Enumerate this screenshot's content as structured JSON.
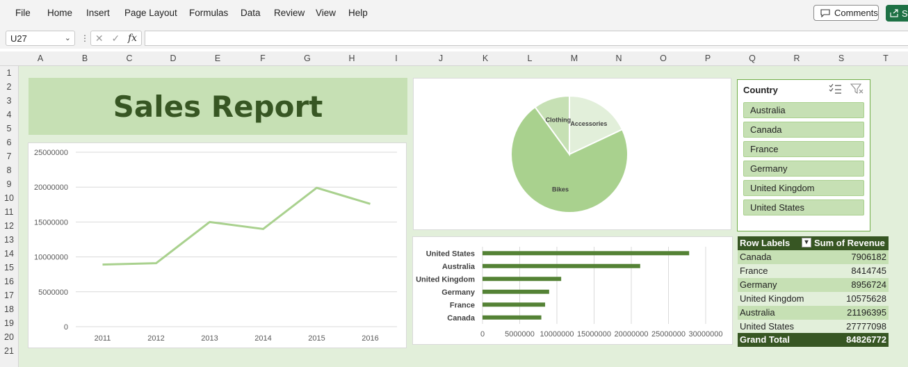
{
  "menu": {
    "items": [
      "File",
      "Home",
      "Insert",
      "Page Layout",
      "Formulas",
      "Data",
      "Review",
      "View",
      "Help"
    ],
    "comments_label": "Comments",
    "share_label": "S"
  },
  "formula_bar": {
    "name_box": "U27",
    "fx": "fx",
    "formula": ""
  },
  "columns": [
    "A",
    "B",
    "C",
    "D",
    "E",
    "F",
    "G",
    "H",
    "I",
    "J",
    "K",
    "L",
    "M",
    "N",
    "O",
    "P",
    "Q",
    "R",
    "S",
    "T"
  ],
  "rows": [
    "1",
    "2",
    "3",
    "4",
    "5",
    "6",
    "7",
    "8",
    "9",
    "10",
    "11",
    "12",
    "13",
    "14",
    "15",
    "16",
    "17",
    "18",
    "19",
    "20",
    "21"
  ],
  "title": "Sales Report",
  "slicer": {
    "title": "Country",
    "items": [
      "Australia",
      "Canada",
      "France",
      "Germany",
      "United Kingdom",
      "United States"
    ]
  },
  "pivot": {
    "header_left": "Row Labels",
    "header_right": "Sum of Revenue",
    "rows": [
      {
        "label": "Canada",
        "value": "7906182"
      },
      {
        "label": "France",
        "value": "8414745"
      },
      {
        "label": "Germany",
        "value": "8956724"
      },
      {
        "label": "United Kingdom",
        "value": "10575628"
      },
      {
        "label": "Australia",
        "value": "21196395"
      },
      {
        "label": "United States",
        "value": "27777098"
      }
    ],
    "total_label": "Grand Total",
    "total_value": "84826772"
  },
  "colors": {
    "dark_green": "#375623",
    "mid_green": "#c6e0b4",
    "light_green": "#e2efda",
    "line_green": "#a9d18e",
    "bar_green": "#548235"
  },
  "chart_data": [
    {
      "type": "line",
      "x": [
        "2011",
        "2012",
        "2013",
        "2014",
        "2015",
        "2016"
      ],
      "values": [
        8900000,
        9100000,
        15000000,
        14000000,
        19900000,
        17600000
      ],
      "ylim": [
        0,
        25000000
      ],
      "yticks": [
        "0",
        "5000000",
        "10000000",
        "15000000",
        "20000000",
        "25000000"
      ],
      "grid": true
    },
    {
      "type": "pie",
      "categories": [
        "Accessories",
        "Bikes",
        "Clothing"
      ],
      "values": [
        0.18,
        0.72,
        0.1
      ]
    },
    {
      "type": "bar",
      "categories": [
        "Canada",
        "France",
        "Germany",
        "United Kingdom",
        "Australia",
        "United States"
      ],
      "values": [
        7906182,
        8414745,
        8956724,
        10575628,
        21196395,
        27777098
      ],
      "xlim": [
        0,
        30000000
      ],
      "xticks": [
        "0",
        "5000000",
        "10000000",
        "15000000",
        "20000000",
        "25000000",
        "30000000"
      ],
      "grid": true
    }
  ]
}
